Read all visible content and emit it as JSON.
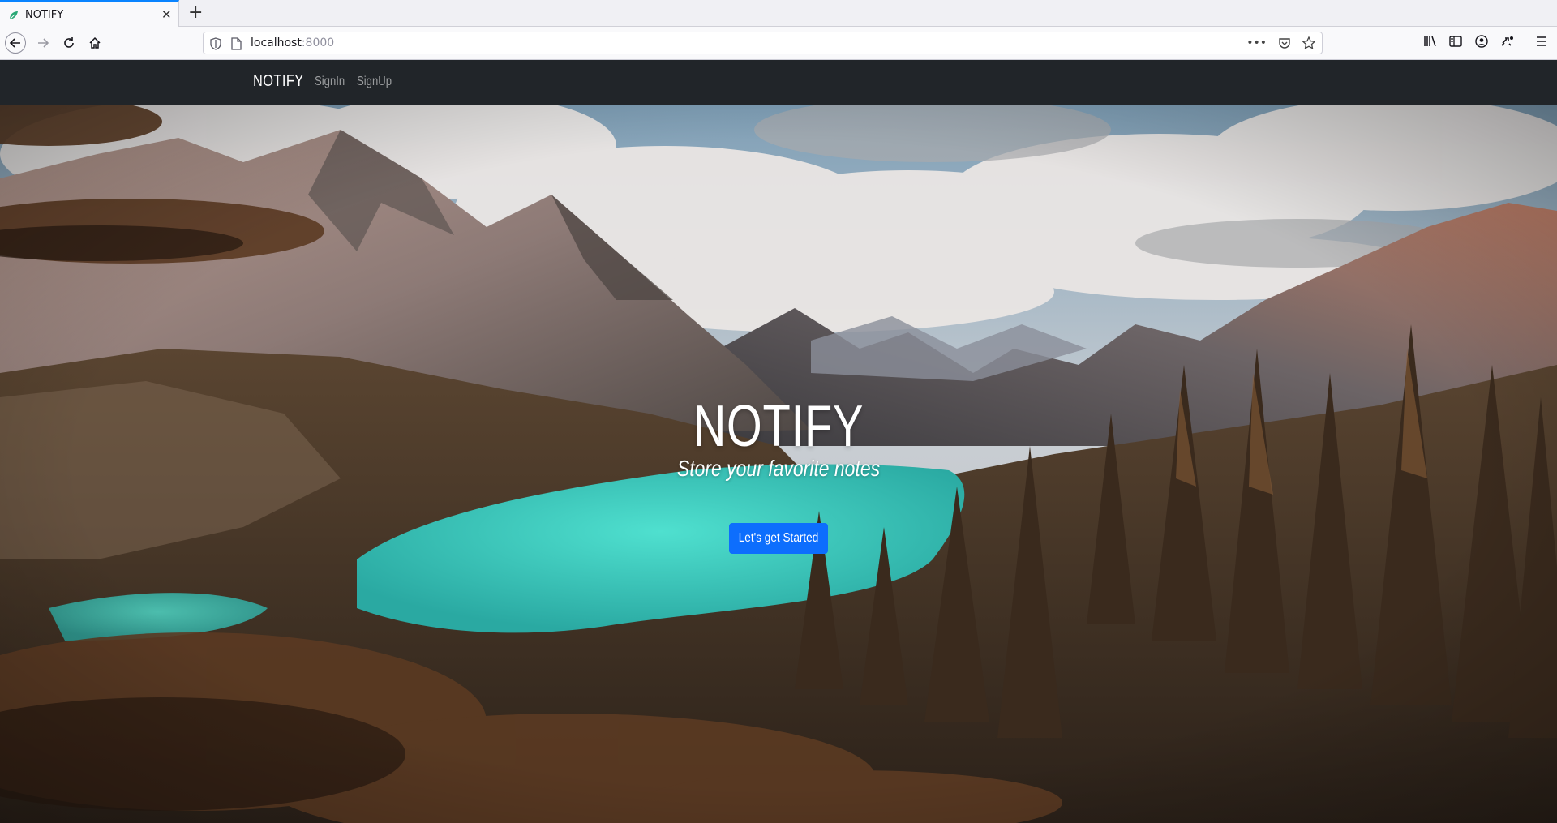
{
  "browser": {
    "tab_title": "NOTIFY",
    "url_host": "localhost",
    "url_port": ":8000",
    "icons": [
      "back-icon",
      "forward-icon",
      "reload-icon",
      "home-icon",
      "page-actions-icon",
      "pocket-icon",
      "bookmark-star-icon",
      "library-icon",
      "sidebar-icon",
      "account-icon",
      "extensions-icon",
      "menu-icon"
    ]
  },
  "site": {
    "brand": "NOTIFY",
    "nav": {
      "signin": "SignIn",
      "signup": "SignUp"
    },
    "hero": {
      "title": "NOTIFY",
      "subtitle": "Store your favorite notes",
      "cta": "Let's get Started"
    },
    "colors": {
      "navbar": "#212529",
      "cta": "#0d6efd",
      "lake": "#3ed0c0"
    }
  }
}
